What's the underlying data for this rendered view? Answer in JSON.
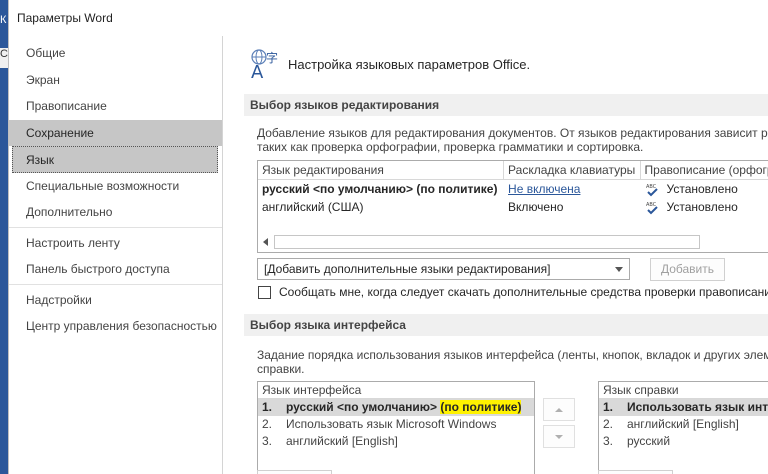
{
  "background": {
    "partial_text_1": "К",
    "partial_text_2": "Са"
  },
  "window": {
    "title": "Параметры Word"
  },
  "nav": {
    "group1": [
      "Общие",
      "Экран",
      "Правописание",
      "Сохранение",
      "Язык",
      "Специальные возможности",
      "Дополнительно"
    ],
    "group2": [
      "Настроить ленту",
      "Панель быстрого доступа"
    ],
    "group3": [
      "Надстройки",
      "Центр управления безопасностью"
    ],
    "hovered": "Сохранение",
    "selected": "Язык"
  },
  "main": {
    "title": "Настройка языковых параметров Office.",
    "icon": "language-icon",
    "editing": {
      "heading": "Выбор языков редактирования",
      "description_line1": "Добавление языков для редактирования документов. От языков редактирования зависит рабо",
      "description_line2": "таких как проверка орфографии, проверка грамматики и сортировка.",
      "columns": [
        "Язык редактирования",
        "Раскладка клавиатуры",
        "Правописание (орфогр"
      ],
      "rows": [
        {
          "language": "русский <по умолчанию> (по политике)",
          "keyboard": "Не включена",
          "proofing": "Установлено"
        },
        {
          "language": "английский (США)",
          "keyboard": "Включено",
          "proofing": "Установлено"
        }
      ],
      "add_combo_value": "[Добавить дополнительные языки редактирования]",
      "add_button": "Добавить",
      "notify_checkbox": "Сообщать мне, когда следует скачать дополнительные средства проверки правописания"
    },
    "interface": {
      "heading": "Выбор языка интерфейса",
      "description_line1": "Задание порядка использования языков интерфейса (ленты, кнопок, вкладок и других элемен",
      "description_line2": "справки.",
      "display_list": {
        "header": "Язык интерфейса",
        "items": [
          {
            "num": "1.",
            "text": "русский <по умолчанию> ",
            "highlight": "(по политике)"
          },
          {
            "num": "2.",
            "text": "Использовать язык Microsoft Windows"
          },
          {
            "num": "3.",
            "text": "английский [English]"
          }
        ]
      },
      "help_list": {
        "header": "Язык справки",
        "items": [
          {
            "num": "1.",
            "text": "Использовать язык интер"
          },
          {
            "num": "2.",
            "text": "английский [English]"
          },
          {
            "num": "3.",
            "text": "русский"
          }
        ]
      }
    }
  },
  "colors": {
    "accent": "#2b579a",
    "highlight": "#fff200",
    "nav_selected": "#c6c6c6",
    "section_bg": "#f0f0f0"
  }
}
